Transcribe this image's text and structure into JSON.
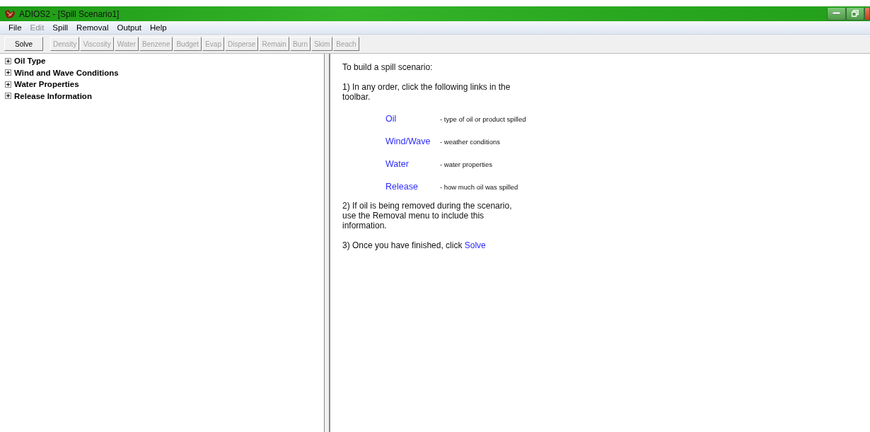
{
  "window": {
    "title": "ADIOS2 - [Spill Scenario1]"
  },
  "menu": [
    {
      "label": "File",
      "disabled": false
    },
    {
      "label": "Edit",
      "disabled": true
    },
    {
      "label": "Spill",
      "disabled": false
    },
    {
      "label": "Removal",
      "disabled": false
    },
    {
      "label": "Output",
      "disabled": false
    },
    {
      "label": "Help",
      "disabled": false
    }
  ],
  "toolbar": [
    {
      "label": "Solve",
      "disabled": false
    },
    {
      "label": "Density",
      "disabled": true
    },
    {
      "label": "Viscosity",
      "disabled": true
    },
    {
      "label": "Water",
      "disabled": true
    },
    {
      "label": "Benzene",
      "disabled": true
    },
    {
      "label": "Budget",
      "disabled": true
    },
    {
      "label": "Evap",
      "disabled": true
    },
    {
      "label": "Disperse",
      "disabled": true
    },
    {
      "label": "Remain",
      "disabled": true
    },
    {
      "label": "Burn",
      "disabled": true
    },
    {
      "label": "Skim",
      "disabled": true
    },
    {
      "label": "Beach",
      "disabled": true
    }
  ],
  "tree": [
    {
      "label": "Oil Type",
      "expanded": false
    },
    {
      "label": "Wind and Wave Conditions",
      "expanded": false
    },
    {
      "label": "Water Properties",
      "expanded": false
    },
    {
      "label": "Release Information",
      "expanded": false
    }
  ],
  "instructions": {
    "heading": "To build a spill scenario:",
    "step_1": "1) In any order, click the following links in the toolbar.",
    "links": [
      {
        "link": "Oil",
        "description": "- type of oil or product spilled"
      },
      {
        "link": "Wind/Wave",
        "description": "- weather conditions"
      },
      {
        "link": "Water",
        "description": "- water properties"
      },
      {
        "link": "Release",
        "description": "- how much oil was spilled"
      }
    ],
    "step_2": "2) If oil is being removed during the scenario, use the Removal menu to include this information.",
    "step_3": "3) Once you have finished, click",
    "step_3_link": "Solve"
  }
}
